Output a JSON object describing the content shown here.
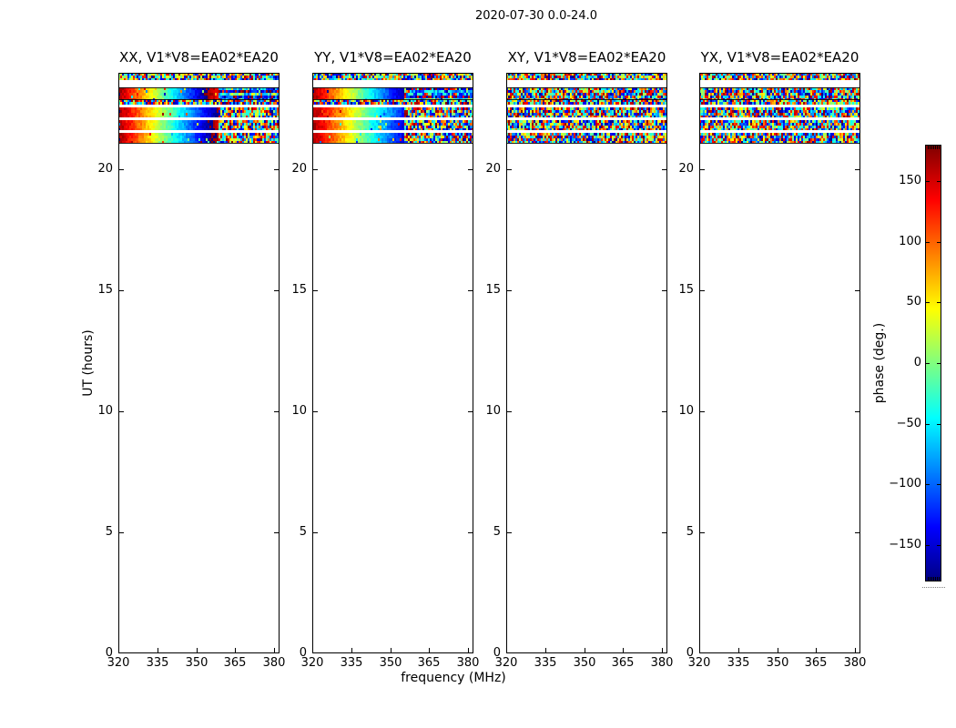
{
  "figure_title": "2020-07-30 0.0-24.0",
  "chart_data": {
    "type": "heatmap",
    "title": "2020-07-30 0.0-24.0",
    "xlabel": "frequency (MHz)",
    "ylabel": "UT (hours)",
    "xlim": [
      320,
      382
    ],
    "ylim": [
      0,
      24
    ],
    "xticks": [
      320,
      335,
      350,
      365,
      380
    ],
    "yticks": [
      20,
      15,
      10,
      5,
      0
    ],
    "grid": false,
    "colormap": "jet",
    "panels": [
      {
        "label": "XX, V1*V8=EA02*EA20",
        "kind": "parallel",
        "noise_start_frac": 0.62,
        "sweep_rate": 600,
        "seed": 11
      },
      {
        "label": "YY, V1*V8=EA02*EA20",
        "kind": "parallel",
        "noise_start_frac": 0.57,
        "sweep_rate": 560,
        "seed": 22
      },
      {
        "label": "XY, V1*V8=EA02*EA20",
        "kind": "cross",
        "seed": 33
      },
      {
        "label": "YX, V1*V8=EA02*EA20",
        "kind": "cross",
        "seed": 44
      }
    ],
    "band": {
      "ut_range": [
        21.1,
        24.0
      ],
      "rows": [
        {
          "y": 0,
          "h": 8,
          "type": "noise"
        },
        {
          "y": 16,
          "h": 13,
          "type": "sweep"
        },
        {
          "y": 29,
          "h": 6,
          "type": "noise"
        },
        {
          "y": 38,
          "h": 11,
          "type": "sweep"
        },
        {
          "y": 52,
          "h": 11,
          "type": "sweep"
        },
        {
          "y": 66,
          "h": 11,
          "type": "sweep"
        }
      ],
      "separator_lines_y": [
        16,
        29,
        77
      ]
    },
    "colorbar": {
      "label": "phase (deg.)",
      "vmin": -180,
      "vmax": 180,
      "ticks": [
        150,
        100,
        50,
        0,
        -50,
        -100,
        -150
      ],
      "tick_labels": [
        "150",
        "100",
        "50",
        "0",
        "−50",
        "−100",
        "−150"
      ],
      "position": "right"
    }
  }
}
